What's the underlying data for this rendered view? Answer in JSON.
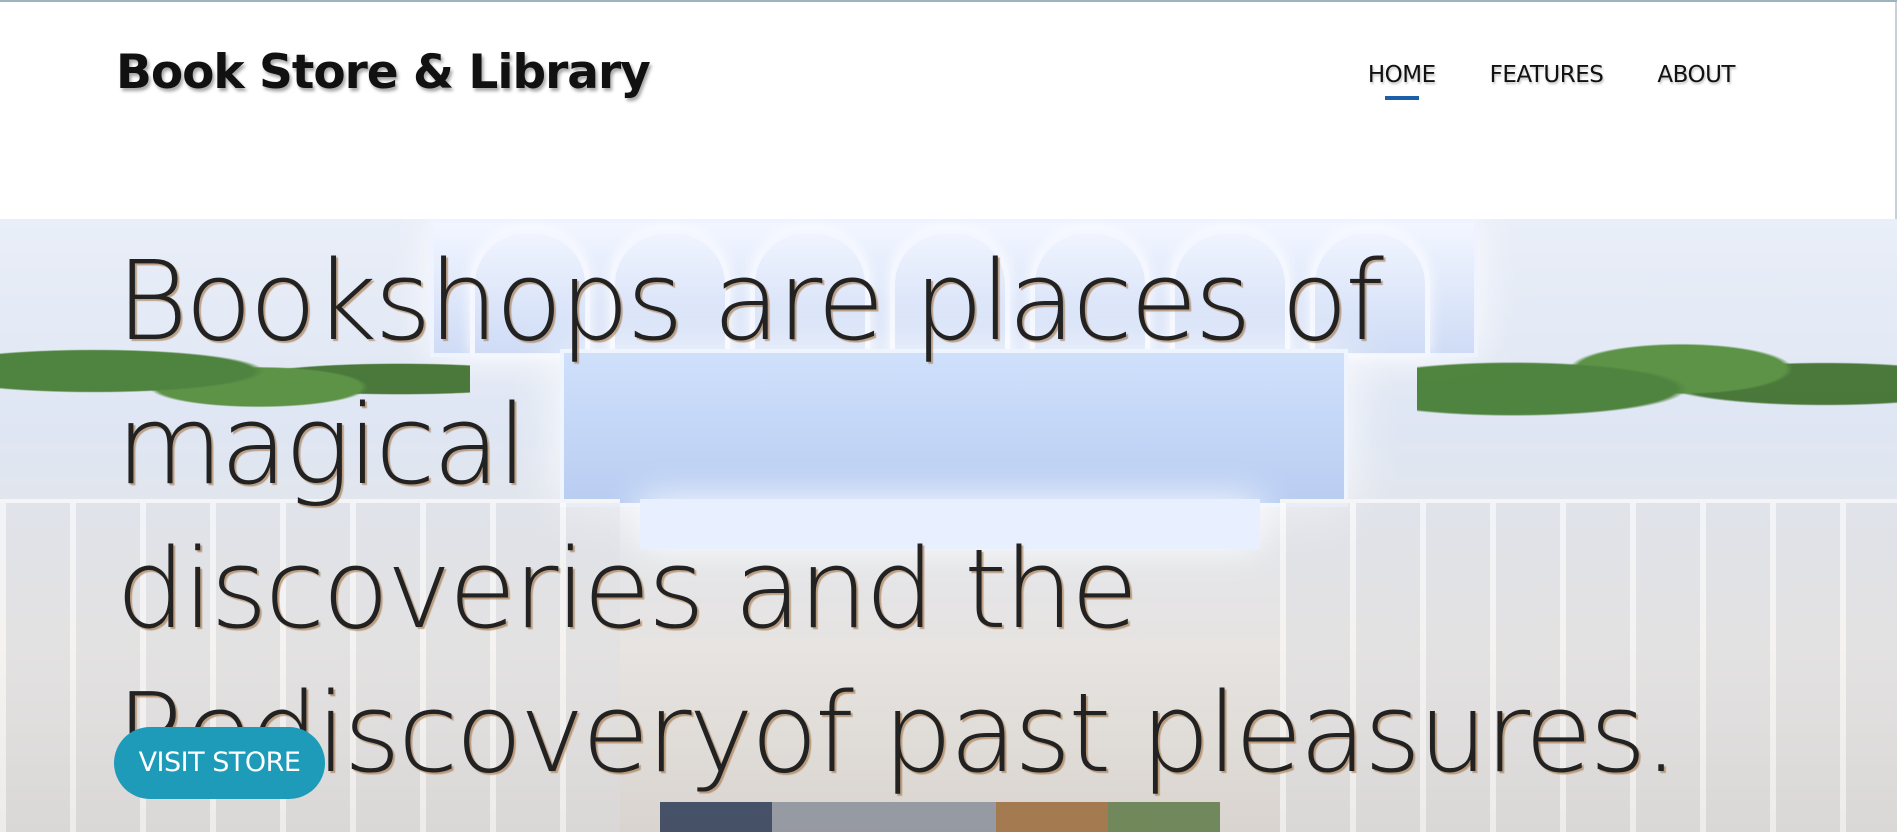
{
  "header": {
    "brand": "Book Store & Library",
    "nav": [
      {
        "label": "HOME",
        "active": true
      },
      {
        "label": "FEATURES",
        "active": false
      },
      {
        "label": "ABOUT",
        "active": false
      }
    ]
  },
  "hero": {
    "lines": [
      "Bookshops are places of magical",
      "discoveries and the",
      "Rediscoveryof past pleasures."
    ],
    "button_label": "VISIT STORE"
  },
  "colors": {
    "accent": "#1c5fa8",
    "button": "#1d9bb8"
  }
}
